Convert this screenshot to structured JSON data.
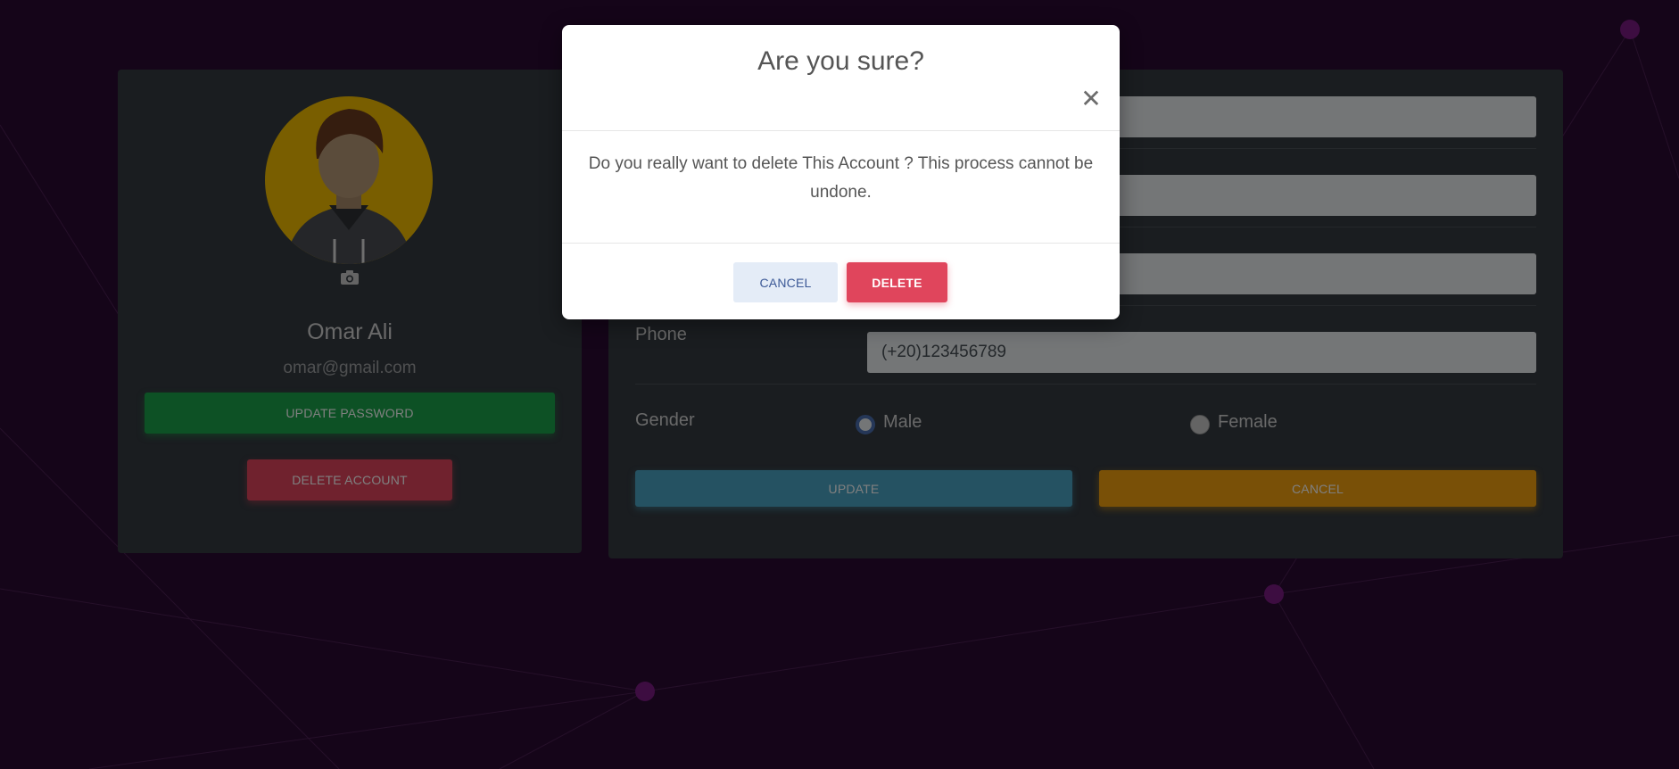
{
  "colors": {
    "background": "#2a0a32",
    "card": "#343a40",
    "avatar_bg": "#f2bd00",
    "success": "#1aa34a",
    "danger": "#e0455c",
    "info": "#4aa5c4",
    "warning": "#f2a10f"
  },
  "profile": {
    "name": "Omar Ali",
    "email": "omar@gmail.com",
    "update_password_label": "UPDATE PASSWORD",
    "delete_account_label": "DELETE ACCOUNT",
    "avatar_icon": "user-avatar-icon",
    "camera_icon": "camera-icon"
  },
  "form": {
    "phone_label": "Phone",
    "phone_value": "(+20)123456789",
    "gender_label": "Gender",
    "gender_options": [
      {
        "label": "Male",
        "selected": true
      },
      {
        "label": "Female",
        "selected": false
      }
    ],
    "update_label": "UPDATE",
    "cancel_label": "CANCEL"
  },
  "modal": {
    "title": "Are you sure?",
    "close_icon": "close-icon",
    "body": "Do you really want to delete This Account ? This process cannot be undone.",
    "cancel_label": "CANCEL",
    "delete_label": "DELETE"
  }
}
